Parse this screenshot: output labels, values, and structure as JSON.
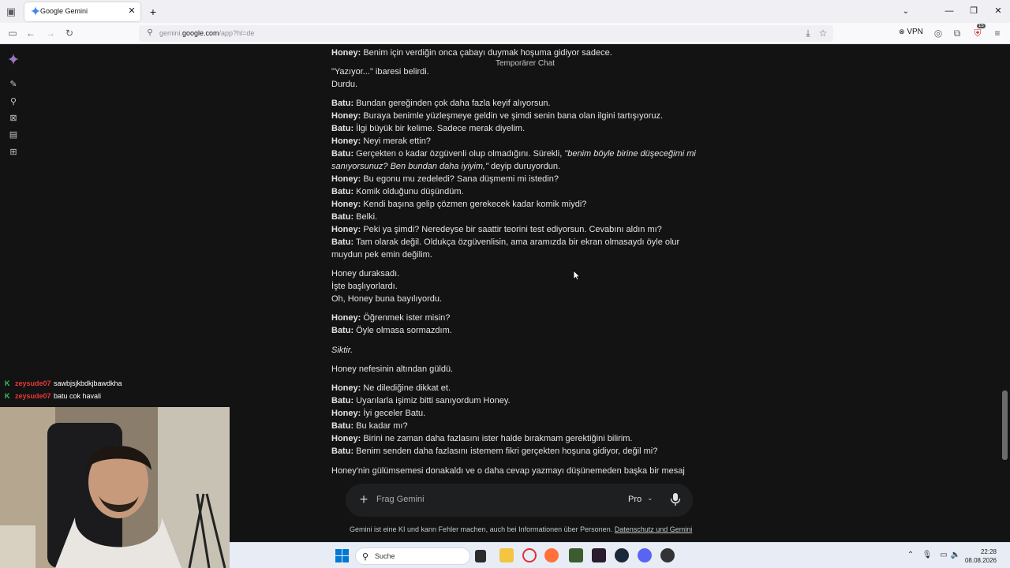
{
  "browser": {
    "tab_title": "Google Gemini",
    "url_prefix": "gemini.",
    "url_domain": "google.com",
    "url_path": "/app?hl=de",
    "vpn_label": "VPN",
    "extension_badge": "15"
  },
  "gemini": {
    "temporary_chat_label": "Temporärer Chat",
    "composer_placeholder": "Frag Gemini",
    "model_label": "Pro",
    "disclaimer_text": "Gemini ist eine KI und kann Fehler machen, auch bei Informationen über Personen.",
    "disclaimer_link": "Datenschutz und Gemini",
    "accent_color": "#4285f4"
  },
  "chat": {
    "b1": [
      {
        "sp": "Honey:",
        "t": " Benim için verdiğin onca çabayı duymak hoşuma gidiyor sadece."
      }
    ],
    "b2": [
      {
        "t": "\"Yazıyor...\" ibaresi belirdi."
      },
      {
        "t": "Durdu."
      }
    ],
    "b3": [
      {
        "sp": "Batu:",
        "t": " Bundan gereğinden çok daha fazla keyif alıyorsun."
      },
      {
        "sp": "Honey:",
        "t": " Buraya benimle yüzleşmeye geldin ve şimdi senin bana olan ilgini tartışıyoruz."
      },
      {
        "sp": "Batu:",
        "t": " İlgi büyük bir kelime. Sadece merak diyelim."
      },
      {
        "sp": "Honey:",
        "t": " Neyi merak ettin?"
      },
      {
        "sp": "Batu:",
        "t": " Gerçekten o kadar özgüvenli olup olmadığını. Sürekli, ",
        "em": "\"benim böyle birine düşeceğimi mi"
      },
      {
        "em": "sanıyorsunuz? Ben bundan daha iyiyim,\"",
        "t": " deyip duruyordun."
      },
      {
        "sp": "Honey:",
        "t": " Bu egonu mu zedeledi? Sana düşmemi mi istedin?"
      },
      {
        "sp": "Batu:",
        "t": " Komik olduğunu düşündüm."
      },
      {
        "sp": "Honey:",
        "t": " Kendi başına gelip çözmen gerekecek kadar komik miydi?"
      },
      {
        "sp": "Batu:",
        "t": " Belki."
      },
      {
        "sp": "Honey:",
        "t": " Peki ya şimdi? Neredeyse bir saattir teorini test ediyorsun. Cevabını aldın mı?"
      },
      {
        "sp": "Batu:",
        "t": " Tam olarak değil. Oldukça özgüvenlisin, ama aramızda bir ekran olmasaydı öyle olur"
      },
      {
        "t": "muydun pek emin değilim."
      }
    ],
    "b4": [
      {
        "t": "Honey duraksadı."
      },
      {
        "t": "İşte başlıyorlardı."
      },
      {
        "t": "Oh, Honey buna bayılıyordu."
      }
    ],
    "b5": [
      {
        "sp": "Honey:",
        "t": " Öğrenmek ister misin?"
      },
      {
        "sp": "Batu:",
        "t": " Öyle olmasa sormazdım."
      }
    ],
    "b6": [
      {
        "em": "Siktir."
      }
    ],
    "b7": [
      {
        "t": "Honey nefesinin altından güldü."
      }
    ],
    "b8": [
      {
        "sp": "Honey:",
        "t": " Ne dilediğine dikkat et."
      },
      {
        "sp": "Batu:",
        "t": " Uyarılarla işimiz bitti sanıyordum Honey."
      },
      {
        "sp": "Honey:",
        "t": " İyi geceler Batu."
      },
      {
        "sp": "Batu:",
        "t": " Bu kadar mı?"
      },
      {
        "sp": "Honey:",
        "t": " Birini ne zaman daha fazlasını ister halde bırakmam gerektiğini bilirim."
      },
      {
        "sp": "Batu:",
        "t": " Benim senden daha fazlasını istemem fikri gerçekten hoşuna gidiyor, değil mi?"
      }
    ],
    "b9": [
      {
        "t": "Honey'nin gülümsemesi donakaldı ve o daha cevap yazmayı düşünemeden başka bir mesaj"
      }
    ]
  },
  "stream_chat": [
    {
      "user": "zeysude07",
      "text": "sawbjsjkbdkjbawdkha"
    },
    {
      "user": "zeysude07",
      "text": "batu cok havali"
    }
  ],
  "taskbar": {
    "search_label": "Suche",
    "time": "22:28",
    "date": "08.08.2026"
  }
}
